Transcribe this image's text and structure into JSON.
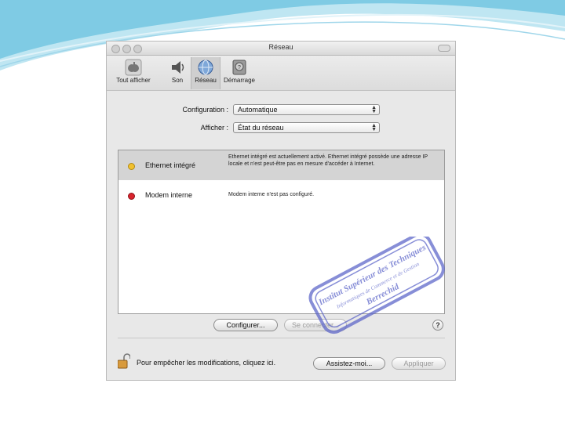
{
  "window": {
    "title": "Réseau"
  },
  "toolbar": {
    "items": [
      {
        "label": "Tout afficher",
        "icon": "apple-icon"
      },
      {
        "label": "Son",
        "icon": "speaker-icon"
      },
      {
        "label": "Réseau",
        "icon": "network-globe-icon",
        "selected": true
      },
      {
        "label": "Démarrage",
        "icon": "startup-disk-icon"
      }
    ]
  },
  "form": {
    "configuration_label": "Configuration :",
    "configuration_value": "Automatique",
    "afficher_label": "Afficher :",
    "afficher_value": "État du réseau"
  },
  "services": [
    {
      "name": "Ethernet intégré",
      "status_color": "#f2c12e",
      "description": "Ethernet intégré est actuellement activé. Ethernet intégré possède une adresse IP locale et n'est peut-être pas en mesure d'accéder à Internet.",
      "selected": true
    },
    {
      "name": "Modem interne",
      "status_color": "#d9232d",
      "description": "Modem interne n'est pas configuré.",
      "selected": false
    }
  ],
  "buttons": {
    "configurer": "Configurer...",
    "se_connecter": "Se connecter...",
    "help": "?",
    "assistez": "Assistez-moi...",
    "appliquer": "Appliquer"
  },
  "lock": {
    "text": "Pour empêcher les modifications, cliquez ici."
  },
  "stamp": {
    "lines": [
      "Institut Supérieur des Techniques",
      "Informatiques de Commerce et de Gestion",
      "Berrechid"
    ],
    "color": "#5a63c8"
  }
}
